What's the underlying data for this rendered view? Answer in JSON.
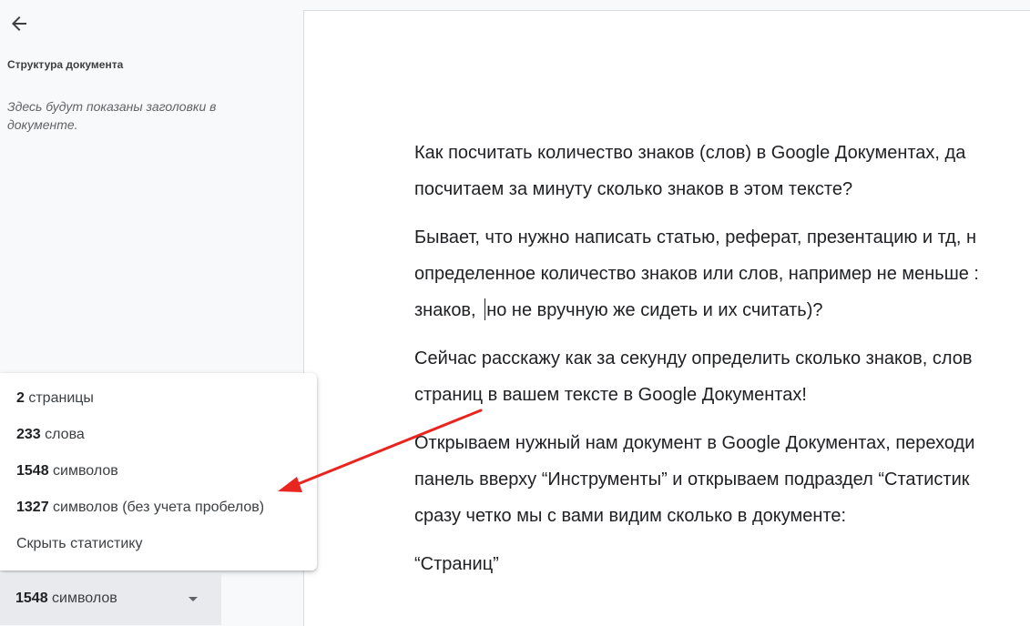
{
  "sidebar": {
    "back_icon": "arrow-left-icon",
    "title": "Структура документа",
    "hint": "Здесь будут показаны заголовки в документе."
  },
  "document": {
    "paragraphs": [
      {
        "lines": [
          "Как посчитать количество знаков (слов) в  Google Документах, да",
          "посчитаем за минуту сколько знаков в этом тексте?"
        ]
      },
      {
        "lines": [
          "Бывает, что нужно написать статью, реферат, презентацию и тд, н",
          "определенное количество знаков или слов, например не меньше :",
          "знаков,  "
        ],
        "cursor_after_line_2": "но не вручную же сидеть и их считать)?"
      },
      {
        "lines": [
          "Сейчас расскажу как за секунду определить сколько знаков, слов",
          "страниц в вашем тексте в Google Документах!"
        ]
      },
      {
        "lines": [
          "Открываем нужный нам документ в Google Документах, переходи",
          "панель вверху “Инструменты” и открываем подраздел  “Статистик",
          "сразу четко мы с вами видим сколько в документе:"
        ]
      },
      {
        "lines": [
          "“Страниц”"
        ]
      }
    ]
  },
  "stats_popup": {
    "pages_num": "2",
    "pages_label": " страницы",
    "words_num": "233",
    "words_label": " слова",
    "chars_num": "1548",
    "chars_label": " символов",
    "chars_ns_num": "1327",
    "chars_ns_label": " символов (без учета пробелов)",
    "hide_label": "Скрыть статистику"
  },
  "stats_chip": {
    "num": "1548",
    "label": " символов",
    "caret_icon": "caret-down-icon"
  },
  "annotation": {
    "color": "#e8251f"
  }
}
